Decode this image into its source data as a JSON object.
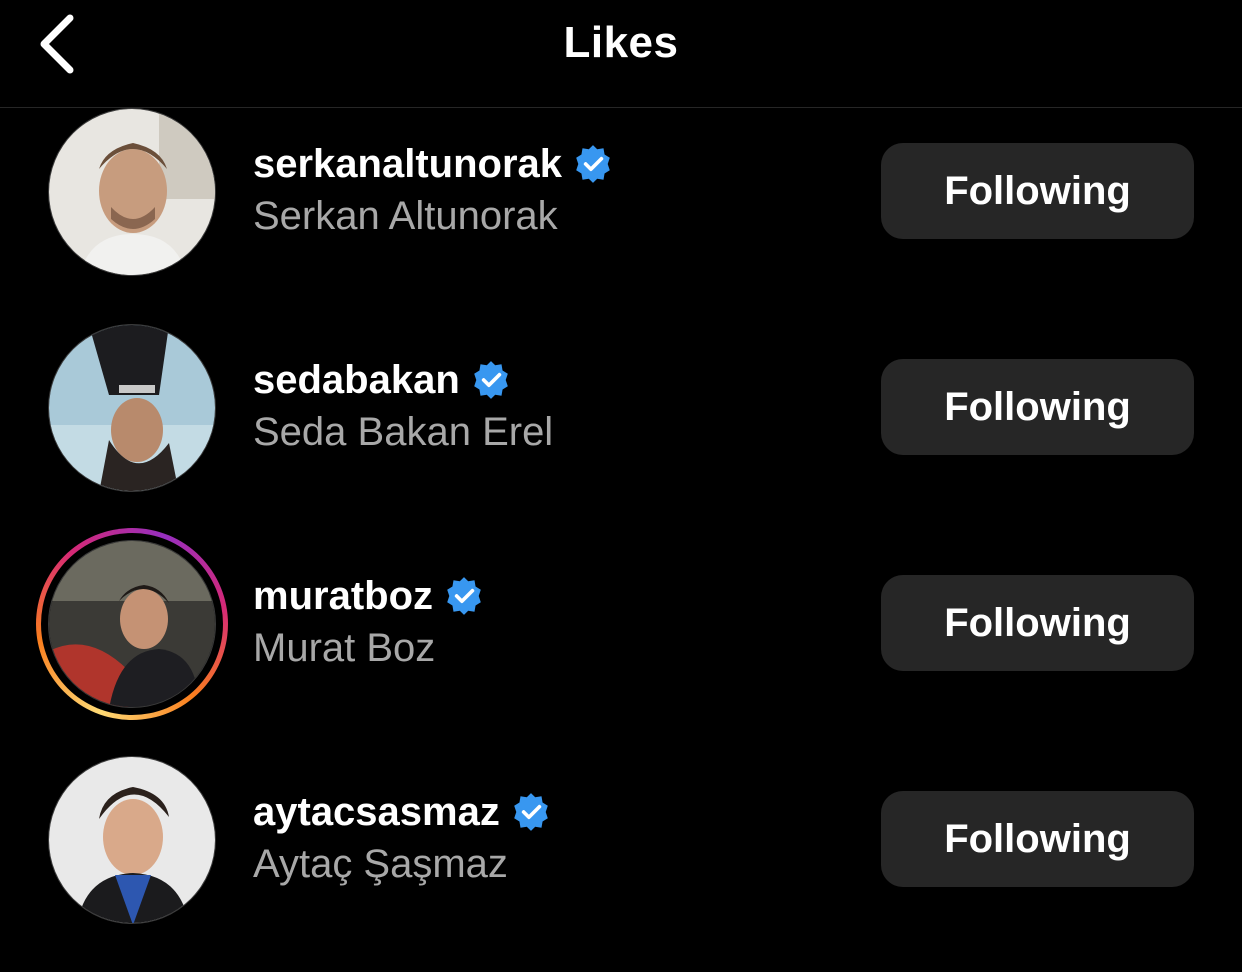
{
  "header": {
    "title": "Likes",
    "back_icon": "chevron-left-icon"
  },
  "colors": {
    "background": "#000000",
    "button_bg": "#262626",
    "verified_blue": "#3897f0",
    "secondary_text": "#a8a8a8"
  },
  "likes": [
    {
      "username": "serkanaltunorak",
      "full_name": "Serkan Altunorak",
      "verified": true,
      "has_story": false,
      "button_label": "Following"
    },
    {
      "username": "sedabakan",
      "full_name": "Seda Bakan Erel",
      "verified": true,
      "has_story": false,
      "button_label": "Following"
    },
    {
      "username": "muratboz",
      "full_name": "Murat Boz",
      "verified": true,
      "has_story": true,
      "button_label": "Following"
    },
    {
      "username": "aytacsasmaz",
      "full_name": "Aytaç Şaşmaz",
      "verified": true,
      "has_story": false,
      "button_label": "Following"
    }
  ]
}
